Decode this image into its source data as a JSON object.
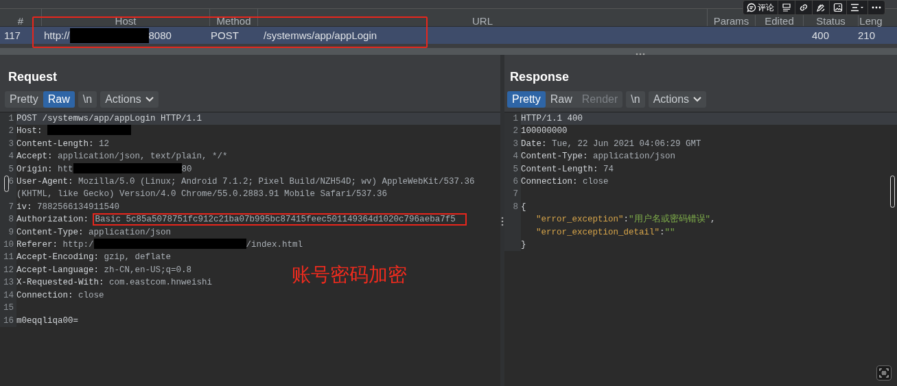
{
  "table": {
    "columns": [
      "#",
      "Host",
      "Method",
      "URL",
      "Params",
      "Edited",
      "Status",
      "Leng"
    ],
    "rows": [
      {
        "selected": true,
        "num": "117",
        "host_prefix": "http://",
        "host_redacted": true,
        "host_suffix": "8080",
        "method": "POST",
        "url": "/systemws/app/appLogin",
        "status": "400",
        "length": "210"
      }
    ]
  },
  "toolbar": {
    "comment_label": "评论"
  },
  "request": {
    "title": "Request",
    "tabs": [
      {
        "label": "Pretty",
        "kind": "view",
        "selected": false,
        "disabled": false
      },
      {
        "label": "Raw",
        "kind": "view",
        "selected": true,
        "disabled": false
      },
      {
        "label": "\\n",
        "kind": "toggle",
        "selected": false,
        "disabled": false
      },
      {
        "label": "Actions",
        "kind": "menu",
        "selected": false,
        "disabled": false
      }
    ],
    "lines": [
      {
        "num": "1",
        "kind": "text",
        "text": "POST /systemws/app/appLogin HTTP/1.1",
        "highlighted": true
      },
      {
        "num": "2",
        "kind": "header",
        "name": "Host:",
        "redacted": true,
        "highlighted": false
      },
      {
        "num": "3",
        "kind": "header",
        "name": "Content-Length:",
        "value": "12",
        "highlighted": false
      },
      {
        "num": "4",
        "kind": "header",
        "name": "Accept:",
        "value": "application/json, text/plain, */*",
        "highlighted": false
      },
      {
        "num": "5",
        "kind": "header",
        "name": "Origin:",
        "value": "htt",
        "redacted": true,
        "value_after": "80",
        "highlighted": false
      },
      {
        "num": "6",
        "kind": "header",
        "name": "User-Agent:",
        "value": "Mozilla/5.0 (Linux; Android 7.1.2; Pixel Build/NZH54D; wv) AppleWebKit/537.36 (KHTML, like Gecko) Version/4.0 Chrome/55.0.2883.91 Mobile Safari/537.36",
        "highlighted": false
      },
      {
        "num": "7",
        "kind": "header",
        "name": "iv:",
        "value": "7882566134911540",
        "highlighted": false
      },
      {
        "num": "8",
        "kind": "header",
        "name": "Authorization:",
        "value": "Basic 5c85a5078751fc912c21ba07b995bc87415feec501149364d1020c796aeba7f5",
        "boxed": true,
        "highlighted": false
      },
      {
        "num": "9",
        "kind": "header",
        "name": "Content-Type:",
        "value": "application/json",
        "highlighted": false
      },
      {
        "num": "10",
        "kind": "header",
        "name": "Referer:",
        "value": "http:/",
        "redacted": true,
        "value_after": "/index.html",
        "highlighted": false
      },
      {
        "num": "11",
        "kind": "header",
        "name": "Accept-Encoding:",
        "value": "gzip, deflate",
        "highlighted": false
      },
      {
        "num": "12",
        "kind": "header",
        "name": "Accept-Language:",
        "value": "zh-CN,en-US;q=0.8",
        "highlighted": false
      },
      {
        "num": "13",
        "kind": "header",
        "name": "X-Requested-With:",
        "value": "com.eastcom.hnweishi",
        "highlighted": false
      },
      {
        "num": "14",
        "kind": "header",
        "name": "Connection:",
        "value": "close",
        "highlighted": false
      },
      {
        "num": "15",
        "kind": "blank",
        "highlighted": false
      },
      {
        "num": "16",
        "kind": "text",
        "text": "m0eqqliqa00=",
        "highlighted": false
      }
    ]
  },
  "response": {
    "title": "Response",
    "tabs": [
      {
        "label": "Pretty",
        "kind": "view",
        "selected": true,
        "disabled": false
      },
      {
        "label": "Raw",
        "kind": "view",
        "selected": false,
        "disabled": false
      },
      {
        "label": "Render",
        "kind": "view",
        "selected": false,
        "disabled": true
      },
      {
        "label": "\\n",
        "kind": "toggle",
        "selected": false,
        "disabled": false
      },
      {
        "label": "Actions",
        "kind": "menu",
        "selected": false,
        "disabled": false
      }
    ],
    "lines": [
      {
        "num": "1",
        "kind": "text",
        "text": "HTTP/1.1 400",
        "highlighted": true
      },
      {
        "num": "2",
        "kind": "text",
        "text": "100000000",
        "highlighted": false
      },
      {
        "num": "3",
        "kind": "header",
        "name": "Date:",
        "value": "Tue, 22 Jun 2021 04:06:29 GMT",
        "highlighted": false
      },
      {
        "num": "4",
        "kind": "header",
        "name": "Content-Type:",
        "value": "application/json",
        "highlighted": false
      },
      {
        "num": "5",
        "kind": "header",
        "name": "Content-Length:",
        "value": "74",
        "highlighted": false
      },
      {
        "num": "6",
        "kind": "header",
        "name": "Connection:",
        "value": "close",
        "highlighted": false
      },
      {
        "num": "7",
        "kind": "blank",
        "highlighted": false
      },
      {
        "num": "8",
        "kind": "json",
        "text": "{",
        "highlighted": false
      },
      {
        "kind": "json_pair",
        "key": "\"error_exception\"",
        "sep": ":",
        "value": "\"用户名或密码错误\"",
        "trail": ",",
        "highlighted": false
      },
      {
        "kind": "json_pair",
        "key": "\"error_exception_detail\"",
        "sep": ":",
        "value": "\"\"",
        "highlighted": false
      },
      {
        "kind": "json",
        "text": "}",
        "highlighted": false
      }
    ]
  },
  "annotation": {
    "note": "账号密码加密"
  }
}
